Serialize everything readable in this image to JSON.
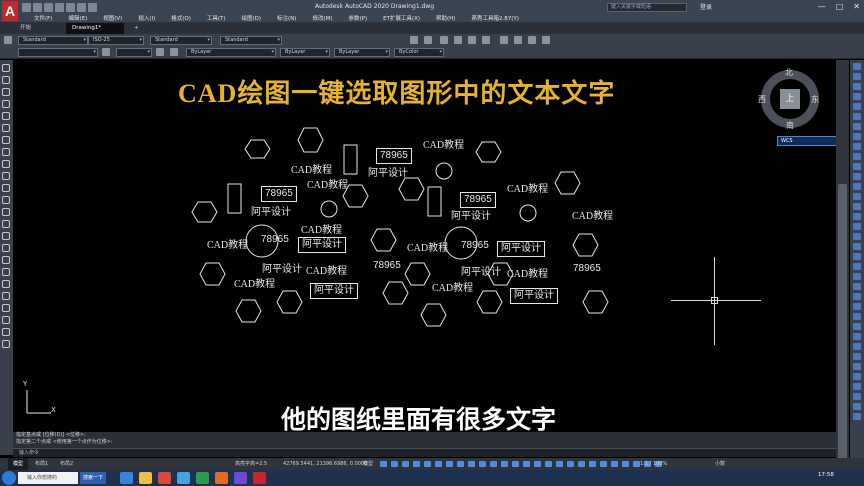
{
  "app": {
    "window_title": "Autodesk AutoCAD 2020    Drawing1.dwg",
    "search_placeholder": "键入关键字或短语",
    "user_label": "登录",
    "win_controls": [
      "—",
      "□",
      "✕"
    ]
  },
  "menu": [
    "文件(F)",
    "编辑(E)",
    "视图(V)",
    "插入(I)",
    "格式(O)",
    "工具(T)",
    "绘图(D)",
    "标注(N)",
    "修改(M)",
    "参数(P)",
    "ET扩展工具(X)",
    "帮助(H)",
    "燕秀工具箱2.87(Y)"
  ],
  "tabs": {
    "start": "开始",
    "active": "Drawing1*",
    "plus": "+"
  },
  "toolbar1": {
    "text_style": "Standard",
    "dim_style": "ISO-25",
    "table_style": "Standard",
    "multileader_style": "Standard"
  },
  "toolbar2": {
    "layer": "",
    "color": "ByLayer",
    "linetype": "ByLayer",
    "lineweight": "ByLayer",
    "plotstyle": "ByColor"
  },
  "canvas": {
    "title": "CAD绘图一键选取图形中的文本文字",
    "texts": [
      {
        "text": "CAD教程",
        "style": ""
      },
      {
        "text": "78965",
        "style": "box num"
      },
      {
        "text": "阿平设计",
        "style": ""
      },
      {
        "text": "CAD教程",
        "style": ""
      },
      {
        "text": "78965",
        "style": "box num"
      },
      {
        "text": "阿平设计",
        "style": ""
      },
      {
        "text": "CAD教程",
        "style": ""
      },
      {
        "text": "CAD教程",
        "style": ""
      },
      {
        "text": "78965",
        "style": "box num"
      },
      {
        "text": "阿平设计",
        "style": ""
      },
      {
        "text": "CAD教程",
        "style": ""
      },
      {
        "text": "CAD教程",
        "style": ""
      },
      {
        "text": "CAD教程",
        "style": ""
      },
      {
        "text": "阿平设计",
        "style": "box"
      },
      {
        "text": "CAD教程",
        "style": ""
      },
      {
        "text": "阿平设计",
        "style": "box"
      },
      {
        "text": "阿平设计",
        "style": ""
      },
      {
        "text": "CAD教程",
        "style": ""
      },
      {
        "text": "78965",
        "style": "num"
      },
      {
        "text": "阿平设计",
        "style": ""
      },
      {
        "text": "CAD教程",
        "style": ""
      },
      {
        "text": "78965",
        "style": "num"
      },
      {
        "text": "CAD教程",
        "style": ""
      },
      {
        "text": "CAD教程",
        "style": ""
      },
      {
        "text": "阿平设计",
        "style": "box"
      },
      {
        "text": "阿平设计",
        "style": "box"
      },
      {
        "text": "78965",
        "style": "num"
      },
      {
        "text": "78965",
        "style": "num"
      }
    ],
    "ucs_x": "X",
    "ucs_y": "Y"
  },
  "viewcube": {
    "north": "北",
    "south": "南",
    "east": "东",
    "west": "西",
    "top": "上",
    "wcs": "WCS"
  },
  "subtitle": "他的图纸里面有很多文字",
  "command": {
    "history1": "指定基点或 [位移(D)] <位移>:",
    "history2": "指定第二个点或 <使用第一个点作为位移>:",
    "prompt": "输入命令"
  },
  "status": {
    "tabs": [
      "模型",
      "布局1",
      "布局2"
    ],
    "annot_scale": "高亮字高=2.5",
    "coords": "42769.5441, 21396.6986, 0.0000",
    "model": "模型",
    "scale": "1:1 / 100%",
    "units": "小数"
  },
  "taskbar": {
    "search": "输入你想搜的",
    "btn": "搜索一下",
    "clock": "17:58"
  }
}
